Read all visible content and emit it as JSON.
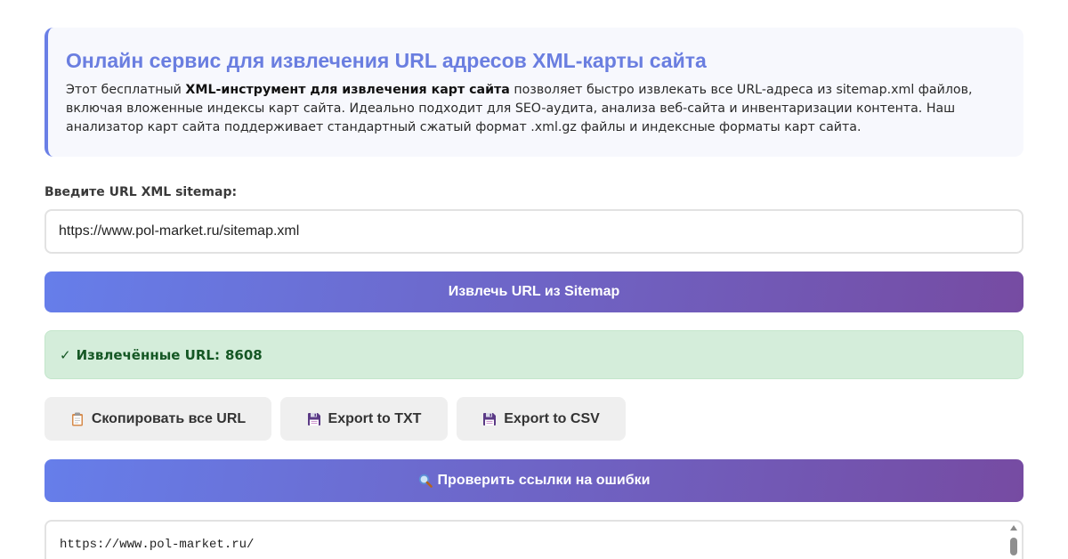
{
  "intro": {
    "title": "Онлайн сервис для извлечения URL адресов XML-карты сайта",
    "text_before": "Этот бесплатный ",
    "text_bold": "XML-инструмент для извлечения карт сайта",
    "text_after": " позволяет быстро извлекать все URL-адреса из sitemap.xml файлов, включая вложенные индексы карт сайта. Идеально подходит для SEO-аудита, анализа веб-сайта и инвентаризации контента. Наш анализатор карт сайта поддерживает стандартный сжатый формат .xml.gz файлы и индексные форматы карт сайта."
  },
  "form": {
    "label": "Введите URL XML sitemap:",
    "url_value": "https://www.pol-market.ru/sitemap.xml",
    "extract_button": "Извлечь URL из Sitemap"
  },
  "status": {
    "check_mark": "✓",
    "label": "Извлечённые URL:",
    "count": "8608"
  },
  "actions": {
    "copy_label": "Скопировать все URL",
    "copy_icon": "clipboard-icon",
    "export_txt_label": "Export to TXT",
    "export_csv_label": "Export to CSV",
    "save_icon": "floppy-disk-icon"
  },
  "check_links": {
    "label": "Проверить ссылки на ошибки",
    "icon": "magnifier-icon"
  },
  "results": {
    "first_url": "https://www.pol-market.ru/"
  },
  "colors": {
    "accent_start": "#667eea",
    "accent_end": "#764ba2",
    "title": "#6a7ee0",
    "success_bg": "#d4edda",
    "success_text": "#155724"
  }
}
